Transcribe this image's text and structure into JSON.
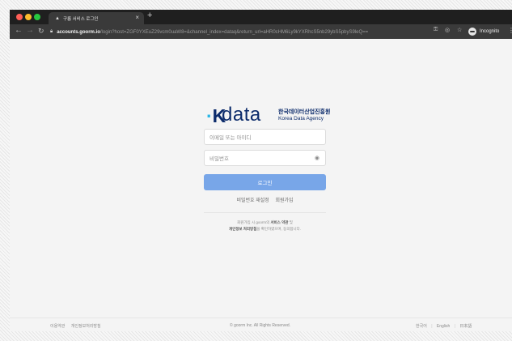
{
  "browser": {
    "tab_title": "구름 서비스 로그인",
    "tab_close": "×",
    "new_tab": "+",
    "url_host": "accounts.goorm.io",
    "url_path": "/login?host=ZGF0YXEuZ29vcm0uaW8=&channel_index=dataq&return_url=aHR0cHM6Ly9kYXRhcS5nb29ybS5pbyS9leQ==",
    "incognito_label": "Incognito"
  },
  "brand": {
    "logo_k": "K",
    "logo_word": "data",
    "name_kr": "한국데이터산업진흥원",
    "name_en": "Korea Data Agency"
  },
  "form": {
    "email_placeholder": "이메일 또는 아이디",
    "password_placeholder": "비밀번호",
    "login_label": "로그인",
    "reset_password": "비밀번호 재설정",
    "signup": "회원가입"
  },
  "agreement": {
    "line1_prefix": "회원가입 시 goorm의 ",
    "terms": "서비스 약관",
    "line1_suffix": " 및",
    "privacy": "개인정보 처리방침",
    "line2_suffix": "을 확인하였으며, 동의합니다."
  },
  "footer": {
    "terms": "이용약관",
    "privacy": "개인정보처리방침",
    "copyright": "© goorm Inc. All Rights Reserved.",
    "lang_ko": "한국어",
    "lang_en": "English",
    "lang_ja": "日本語",
    "separator": "|"
  },
  "colors": {
    "brand_navy": "#0c2b6b",
    "brand_cyan": "#29b6e5",
    "login_button": "#78a6e8"
  }
}
